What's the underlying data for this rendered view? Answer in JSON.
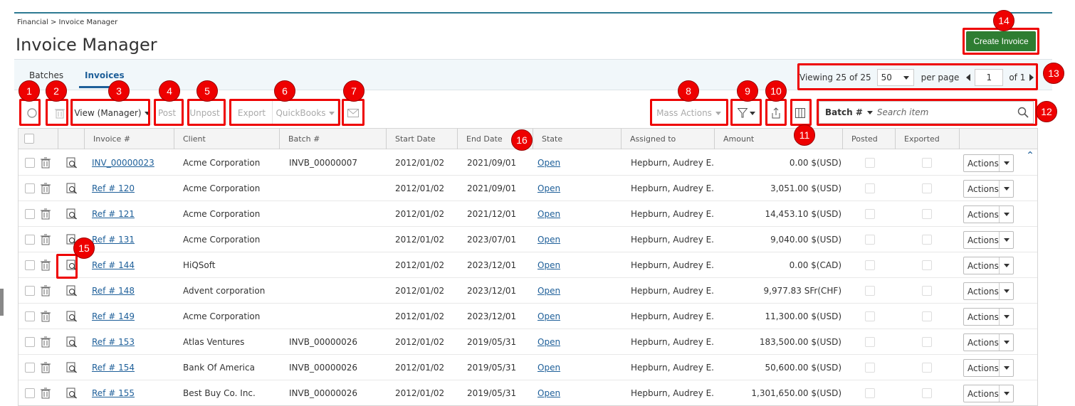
{
  "breadcrumb": "Financial > Invoice Manager",
  "page_title": "Invoice Manager",
  "create_button": "Create Invoice",
  "tabs": [
    {
      "label": "Batches"
    },
    {
      "label": "Invoices"
    }
  ],
  "pager": {
    "viewing_prefix": "Viewing",
    "viewing_value": "25 of 25",
    "per_page_value": "50",
    "per_page_label": "per page",
    "page": "1",
    "of_label": "of 1"
  },
  "toolbar": {
    "view": "View (Manager)",
    "post": "Post",
    "unpost": "Unpost",
    "export": "Export",
    "quickbooks": "QuickBooks",
    "mass_actions": "Mass Actions"
  },
  "search": {
    "type": "Batch #",
    "placeholder": "Search item"
  },
  "columns": [
    "Invoice #",
    "Client",
    "Batch #",
    "Start Date",
    "End Date",
    "State",
    "Assigned to",
    "Amount",
    "Posted",
    "Exported"
  ],
  "rows": [
    {
      "invoice": "INV_00000023",
      "client": "Acme Corporation",
      "batch": "INVB_00000007",
      "start": "2012/01/02",
      "end": "2021/09/01",
      "state": "Open",
      "assigned": "Hepburn, Audrey E.",
      "amount": "0.00 $(USD)",
      "actions": "Actions"
    },
    {
      "invoice": "Ref # 120",
      "client": "Acme Corporation",
      "batch": "",
      "start": "2012/01/02",
      "end": "2021/09/01",
      "state": "Open",
      "assigned": "Hepburn, Audrey E.",
      "amount": "3,051.00 $(USD)",
      "actions": "Actions"
    },
    {
      "invoice": "Ref # 121",
      "client": "Acme Corporation",
      "batch": "",
      "start": "2012/01/02",
      "end": "2021/12/01",
      "state": "Open",
      "assigned": "Hepburn, Audrey E.",
      "amount": "14,453.10 $(USD)",
      "actions": "Actions"
    },
    {
      "invoice": "Ref # 131",
      "client": "Acme Corporation",
      "batch": "",
      "start": "2012/01/02",
      "end": "2023/07/01",
      "state": "Open",
      "assigned": "Hepburn, Audrey E.",
      "amount": "9,040.00 $(USD)",
      "actions": "Actions"
    },
    {
      "invoice": "Ref # 144",
      "client": "HiQSoft",
      "batch": "",
      "start": "2012/01/02",
      "end": "2023/12/01",
      "state": "Open",
      "assigned": "Hepburn, Audrey E.",
      "amount": "0.00 $(CAD)",
      "actions": "Actions"
    },
    {
      "invoice": "Ref # 148",
      "client": "Advent corporation",
      "batch": "",
      "start": "2012/01/02",
      "end": "2023/12/01",
      "state": "Open",
      "assigned": "Hepburn, Audrey E.",
      "amount": "9,977.83 SFr(CHF)",
      "actions": "Actions"
    },
    {
      "invoice": "Ref # 149",
      "client": "Acme Corporation",
      "batch": "",
      "start": "2012/01/02",
      "end": "2023/12/01",
      "state": "Open",
      "assigned": "Hepburn, Audrey E.",
      "amount": "11,300.00 $(USD)",
      "actions": "Actions"
    },
    {
      "invoice": "Ref # 153",
      "client": "Atlas Ventures",
      "batch": "INVB_00000026",
      "start": "2012/01/02",
      "end": "2019/05/31",
      "state": "Open",
      "assigned": "Hepburn, Audrey E.",
      "amount": "183,500.00 $(USD)",
      "actions": "Actions"
    },
    {
      "invoice": "Ref # 154",
      "client": "Bank Of America",
      "batch": "INVB_00000026",
      "start": "2012/01/02",
      "end": "2019/05/31",
      "state": "Open",
      "assigned": "Hepburn, Audrey E.",
      "amount": "50,600.00 $(USD)",
      "actions": "Actions"
    },
    {
      "invoice": "Ref # 155",
      "client": "Best Buy Co. Inc.",
      "batch": "INVB_00000026",
      "start": "2012/01/02",
      "end": "2019/05/31",
      "state": "Open",
      "assigned": "Hepburn, Audrey E.",
      "amount": "1,301,650.00 $(USD)",
      "actions": "Actions"
    }
  ],
  "annotations": [
    "1",
    "2",
    "3",
    "4",
    "5",
    "6",
    "7",
    "8",
    "9",
    "10",
    "11",
    "12",
    "13",
    "14",
    "15",
    "16"
  ],
  "colors": {
    "accent": "#1e5f99",
    "create": "#2e7d32",
    "annotation": "#ee0000"
  }
}
